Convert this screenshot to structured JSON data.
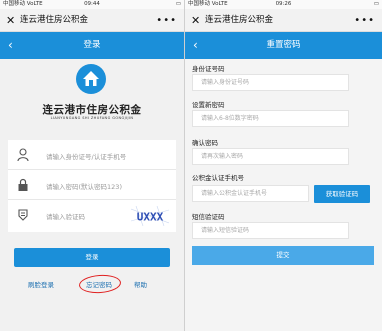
{
  "left": {
    "status": {
      "carrier": "中国移动 VoLTE",
      "time": "09:44",
      "battery": ""
    },
    "wechat": {
      "close": "✕",
      "title": "连云港住房公积金",
      "menu": "•••"
    },
    "header": {
      "back": "‹",
      "title": "登录"
    },
    "logo": {
      "name": "连云港市住房公积金",
      "english": "LIANYUNGANG SHI ZHUFANG GONGJIJIN"
    },
    "fields": {
      "id_placeholder": "请输入身份证号/认证手机号",
      "password_placeholder": "请输入密码(默认密码123)",
      "captcha_placeholder": "请输入验证码",
      "captcha_text": "UXXX"
    },
    "login_button": "登录",
    "links": {
      "face_login": "刷脸登录",
      "forgot_password": "忘记密码",
      "help": "帮助"
    }
  },
  "right": {
    "status": {
      "carrier": "中国移动 VoLTE",
      "time": "09:26",
      "battery": ""
    },
    "wechat": {
      "close": "✕",
      "title": "连云港住房公积金",
      "menu": "•••"
    },
    "header": {
      "back": "‹",
      "title": "重置密码"
    },
    "form": {
      "id_label": "身份证号码",
      "id_placeholder": "请输入身份证号码",
      "new_pw_label": "设置新密码",
      "new_pw_placeholder": "请输入6-8位数字密码",
      "confirm_label": "确认密码",
      "confirm_placeholder": "请再次输入密码",
      "phone_label": "公积金认证手机号",
      "phone_placeholder": "请输入公积金认证手机号",
      "get_code_button": "获取验证码",
      "sms_label": "短信验证码",
      "sms_placeholder": "请输入短信验证码",
      "submit_button": "提交"
    }
  },
  "colors": {
    "primary": "#1b8fd9",
    "annotation": "#e02020"
  }
}
